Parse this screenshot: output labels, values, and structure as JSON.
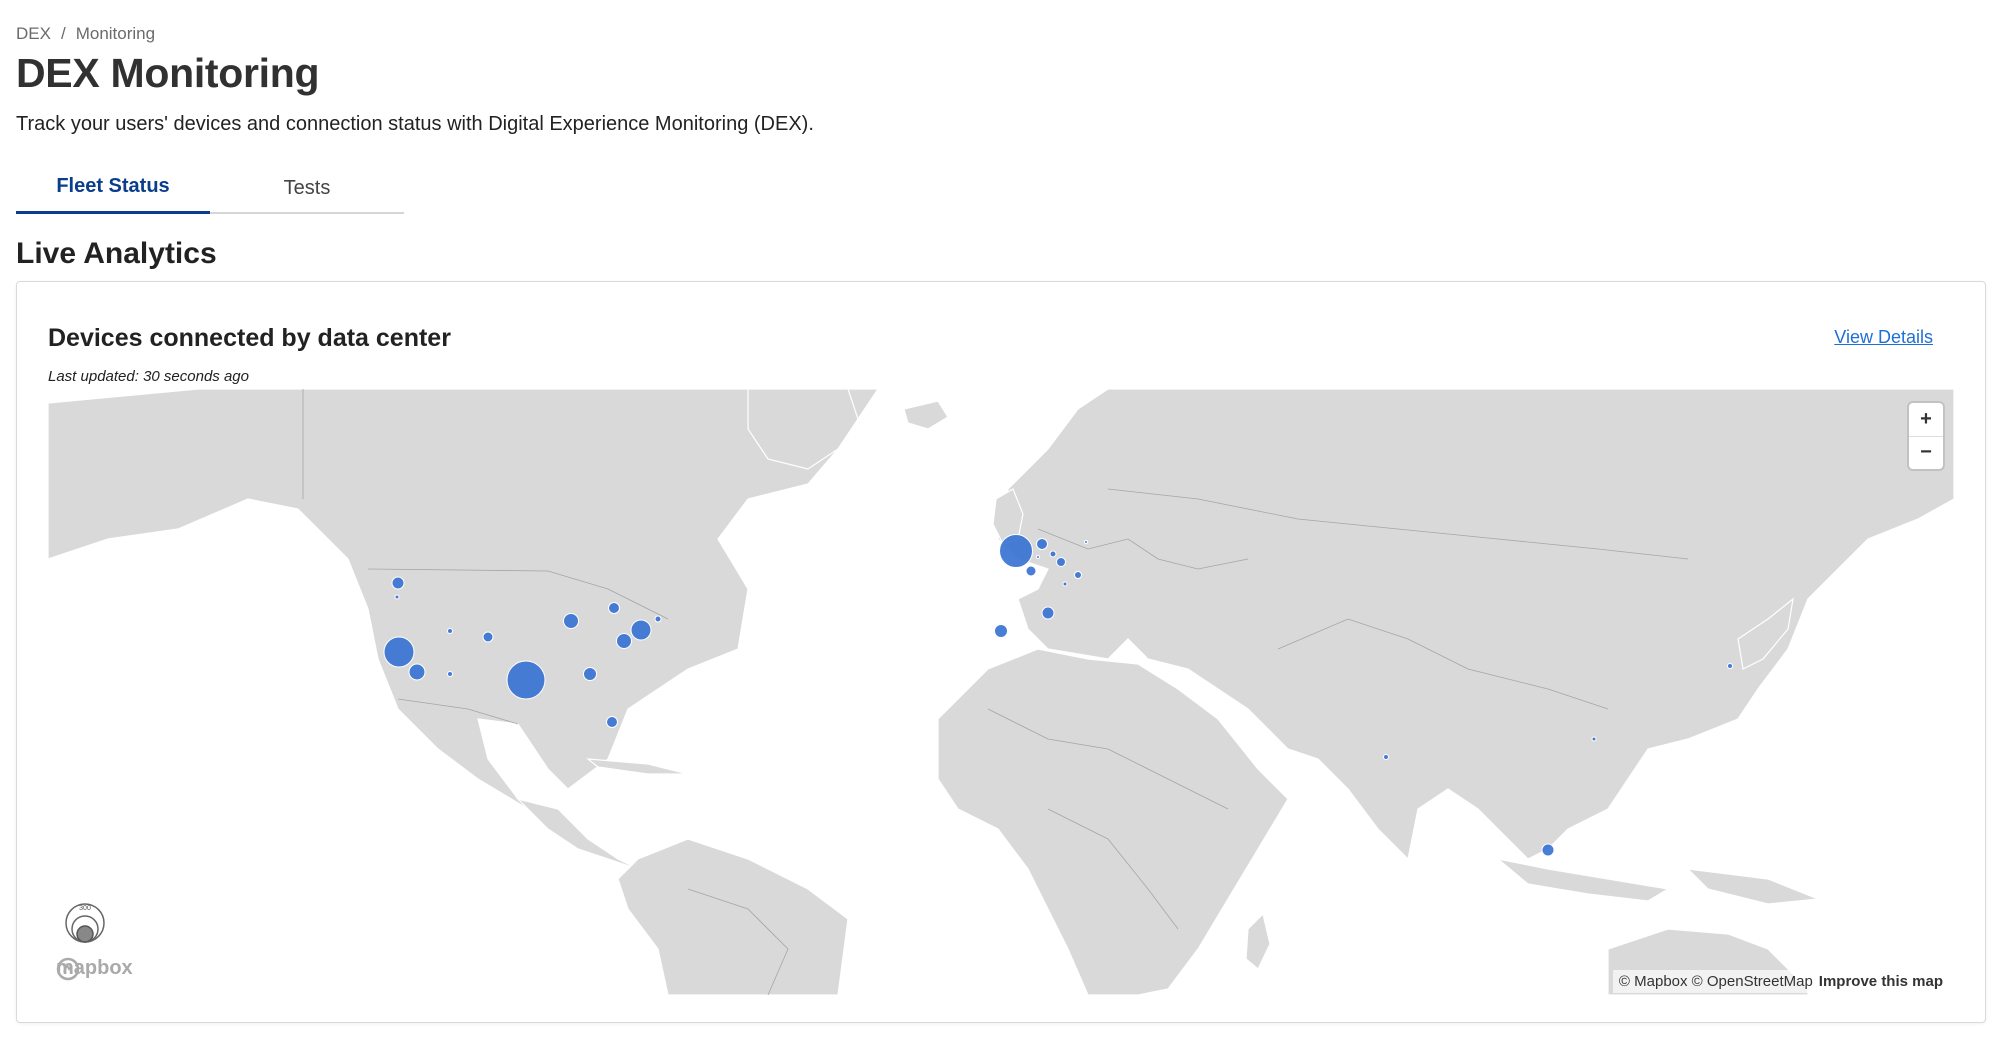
{
  "breadcrumb": {
    "root": "DEX",
    "separator": "/",
    "current": "Monitoring"
  },
  "page": {
    "title": "DEX Monitoring",
    "subtitle": "Track your users' devices and connection status with Digital Experience Monitoring (DEX)."
  },
  "tabs": [
    {
      "label": "Fleet Status",
      "active": true
    },
    {
      "label": "Tests",
      "active": false
    }
  ],
  "section": {
    "title": "Live Analytics"
  },
  "card": {
    "title": "Devices connected by data center",
    "view_details": "View Details",
    "last_updated": "Last updated: 30 seconds ago"
  },
  "map": {
    "zoom_in": "+",
    "zoom_out": "−",
    "logo": "mapbox",
    "attribution": "© Mapbox © OpenStreetMap",
    "improve": "Improve this map",
    "land_color": "#d9d9d9",
    "border_color": "#999999",
    "bubble_color": "#3a73d4",
    "legend_icon": "bubble-size-legend-icon",
    "legend_label": "300"
  }
}
